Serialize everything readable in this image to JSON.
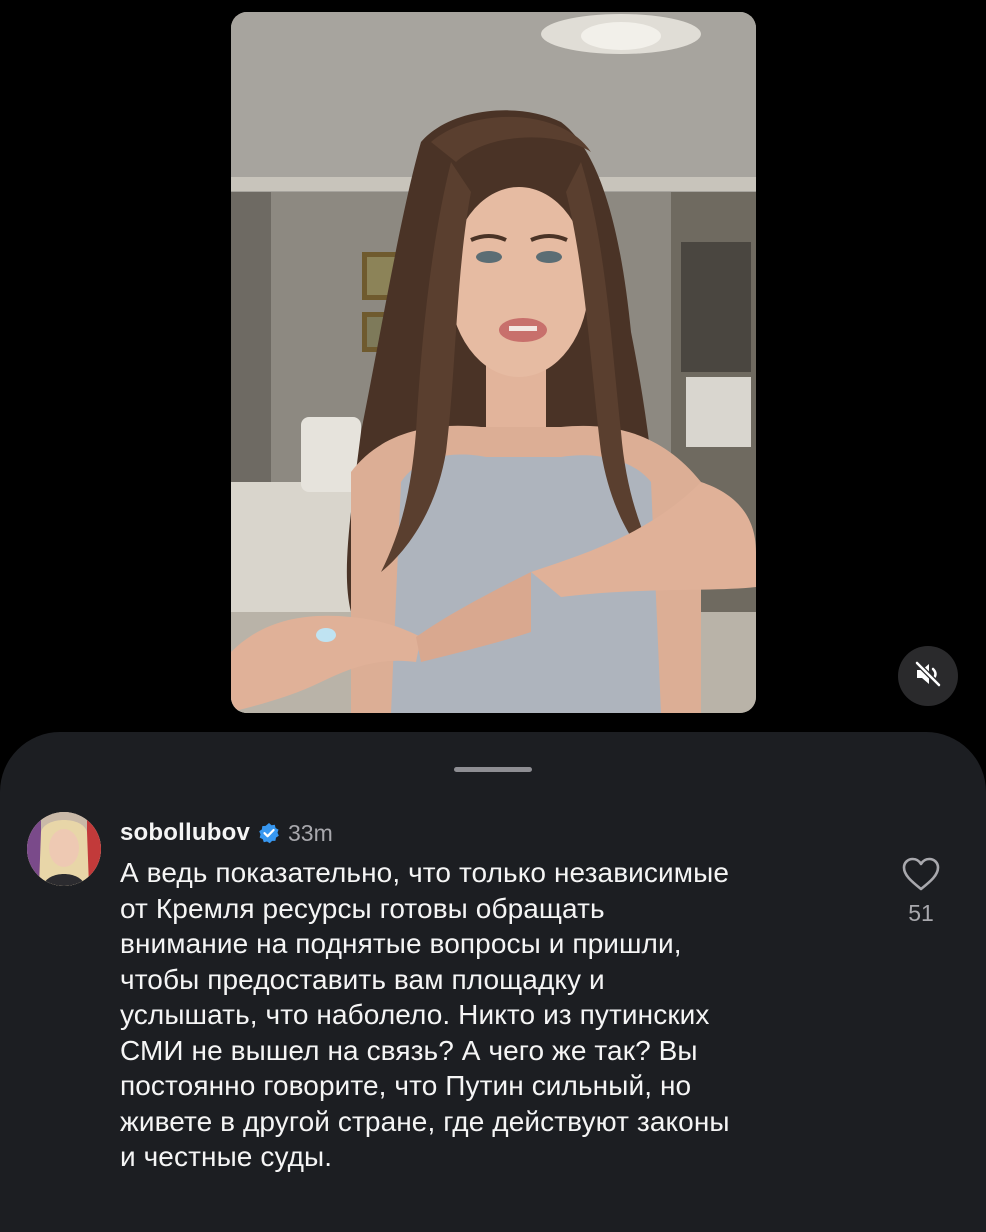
{
  "video": {
    "media_description_icon": "video-frame",
    "mute_icon": "muted-speaker-icon"
  },
  "comment": {
    "username": "sobollubov",
    "verified_icon": "verified-badge-icon",
    "time": "33m",
    "text": "А ведь показательно, что только независимые\nот Кремля ресурсы готовы обращать\nвнимание на поднятые вопросы и пришли,\nчтобы предоставить вам площадку и\nуслышать, что наболело. Никто из путинских\nСМИ не вышел на связь? А чего же так? Вы\nпостоянно говорите, что Путин сильный, но\nживете в другой стране, где действуют законы\nи честные суды.",
    "like_icon": "heart-outline-icon",
    "like_count": "51"
  },
  "colors": {
    "background": "#000000",
    "sheet": "#1c1e22",
    "verified": "#3797f0",
    "muted_text": "#a8a8ad"
  }
}
